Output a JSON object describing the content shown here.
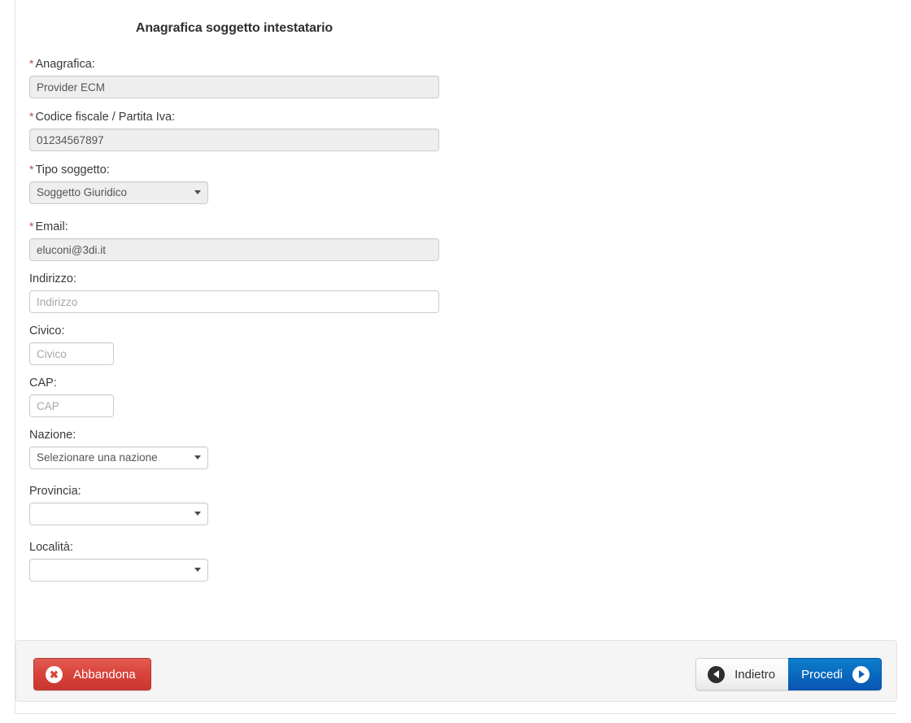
{
  "form": {
    "title": "Anagrafica soggetto intestatario",
    "required_marker": "*",
    "fields": [
      {
        "key": "anagrafica",
        "label": "Anagrafica:",
        "required": true,
        "type": "text",
        "value": "Provider ECM",
        "placeholder": "",
        "readonly": true,
        "width": "full"
      },
      {
        "key": "codice_fiscale",
        "label": "Codice fiscale / Partita Iva:",
        "required": true,
        "type": "text",
        "value": "01234567897",
        "placeholder": "",
        "readonly": true,
        "width": "full"
      },
      {
        "key": "tipo_soggetto",
        "label": "Tipo soggetto:",
        "required": true,
        "type": "select",
        "value": "Soggetto Giuridico",
        "readonly": true,
        "width": "select"
      },
      {
        "key": "email",
        "label": "Email:",
        "required": true,
        "type": "text",
        "value": "eluconi@3di.it",
        "placeholder": "",
        "readonly": true,
        "width": "full"
      },
      {
        "key": "indirizzo",
        "label": "Indirizzo:",
        "required": false,
        "type": "text",
        "value": "",
        "placeholder": "Indirizzo",
        "readonly": false,
        "width": "full"
      },
      {
        "key": "civico",
        "label": "Civico:",
        "required": false,
        "type": "text",
        "value": "",
        "placeholder": "Civico",
        "readonly": false,
        "width": "small"
      },
      {
        "key": "cap",
        "label": "CAP:",
        "required": false,
        "type": "text",
        "value": "",
        "placeholder": "CAP",
        "readonly": false,
        "width": "small"
      },
      {
        "key": "nazione",
        "label": "Nazione:",
        "required": false,
        "type": "select",
        "value": "Selezionare una nazione",
        "readonly": false,
        "width": "select"
      },
      {
        "key": "provincia",
        "label": "Provincia:",
        "required": false,
        "type": "select",
        "value": "",
        "readonly": false,
        "width": "select"
      },
      {
        "key": "localita",
        "label": "Località:",
        "required": false,
        "type": "select",
        "value": "",
        "readonly": false,
        "width": "select"
      }
    ]
  },
  "footer": {
    "abandon_label": "Abbandona",
    "back_label": "Indietro",
    "proceed_label": "Procedi",
    "abandon_icon": "circle-x-icon",
    "back_icon": "circle-chevron-left-icon",
    "proceed_icon": "circle-chevron-right-icon"
  },
  "colors": {
    "required_star": "#b94a48",
    "abandon_red": "#d9433c",
    "proceed_blue": "#0b63bd",
    "readonly_field": "#eeeeee",
    "footer_bg": "#f5f5f5"
  }
}
